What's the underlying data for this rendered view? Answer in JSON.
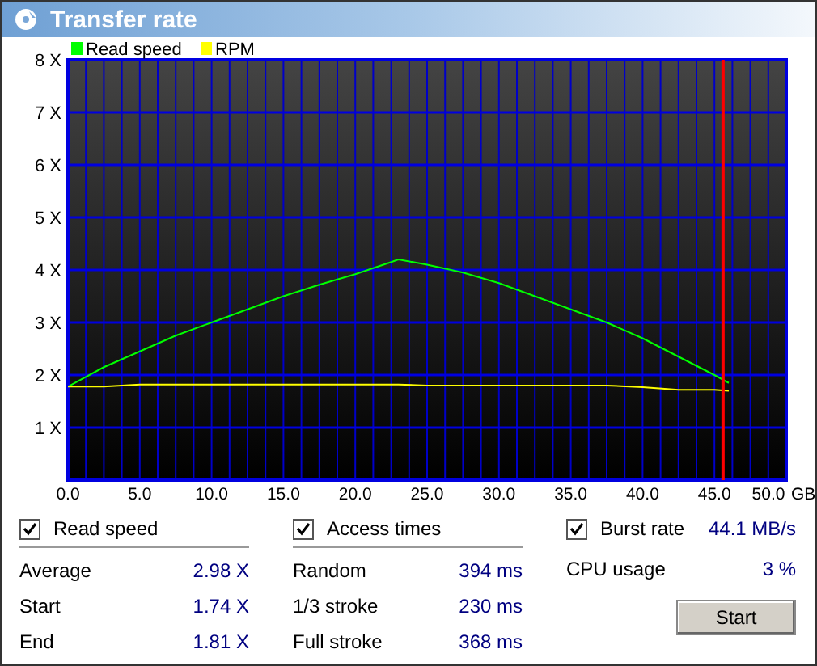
{
  "window": {
    "title": "Transfer rate"
  },
  "chart": {
    "chart_data": {
      "type": "line",
      "xlabel": "GB",
      "x": [
        0,
        2.5,
        5,
        7.5,
        10,
        12.5,
        15,
        17.5,
        20,
        22.5,
        23,
        25,
        27.5,
        30,
        32.5,
        35,
        37.5,
        40,
        42.5,
        45,
        46
      ],
      "series": [
        {
          "name": "Read speed",
          "color": "#00ff00",
          "values": [
            1.78,
            2.15,
            2.45,
            2.75,
            3.0,
            3.25,
            3.5,
            3.72,
            3.92,
            4.15,
            4.2,
            4.1,
            3.95,
            3.75,
            3.5,
            3.25,
            3.0,
            2.7,
            2.35,
            2.0,
            1.85
          ]
        },
        {
          "name": "RPM",
          "color": "#ffff00",
          "values": [
            1.78,
            1.78,
            1.82,
            1.82,
            1.82,
            1.82,
            1.82,
            1.82,
            1.82,
            1.82,
            1.82,
            1.8,
            1.8,
            1.8,
            1.8,
            1.8,
            1.8,
            1.77,
            1.72,
            1.72,
            1.7
          ]
        }
      ],
      "xlim": [
        0,
        50
      ],
      "ylim": [
        0,
        8
      ],
      "xticks": [
        {
          "value": 0,
          "label": "0.0"
        },
        {
          "value": 5,
          "label": "5.0"
        },
        {
          "value": 10,
          "label": "10.0"
        },
        {
          "value": 15,
          "label": "15.0"
        },
        {
          "value": 20,
          "label": "20.0"
        },
        {
          "value": 25,
          "label": "25.0"
        },
        {
          "value": 30,
          "label": "30.0"
        },
        {
          "value": 35,
          "label": "35.0"
        },
        {
          "value": 40,
          "label": "40.0"
        },
        {
          "value": 45,
          "label": "45.0"
        },
        {
          "value": 50,
          "label": "50.0"
        }
      ],
      "yticks": [
        {
          "value": 1,
          "label": "1 X"
        },
        {
          "value": 2,
          "label": "2 X"
        },
        {
          "value": 3,
          "label": "3 X"
        },
        {
          "value": 4,
          "label": "4 X"
        },
        {
          "value": 5,
          "label": "5 X"
        },
        {
          "value": 6,
          "label": "6 X"
        },
        {
          "value": 7,
          "label": "7 X"
        },
        {
          "value": 8,
          "label": "8 X"
        }
      ],
      "ref_lines": [
        {
          "axis": "x",
          "value": 45.6,
          "color": "#ff0000"
        }
      ],
      "grid": true,
      "legend": true
    }
  },
  "sections": [
    {
      "title": "Read speed",
      "checked": true,
      "rows": [
        {
          "label": "Average",
          "value": "2.98 X"
        },
        {
          "label": "Start",
          "value": "1.74 X"
        },
        {
          "label": "End",
          "value": "1.81 X"
        }
      ]
    },
    {
      "title": "Access times",
      "checked": true,
      "rows": [
        {
          "label": "Random",
          "value": "394 ms"
        },
        {
          "label": "1/3 stroke",
          "value": "230 ms"
        },
        {
          "label": "Full stroke",
          "value": "368 ms"
        }
      ]
    },
    {
      "title": "Burst rate",
      "checked": true,
      "value": "44.1 MB/s",
      "rows": [
        {
          "label": "CPU usage",
          "value": "3 %"
        }
      ]
    }
  ],
  "buttons": [
    {
      "label": "Start"
    }
  ]
}
